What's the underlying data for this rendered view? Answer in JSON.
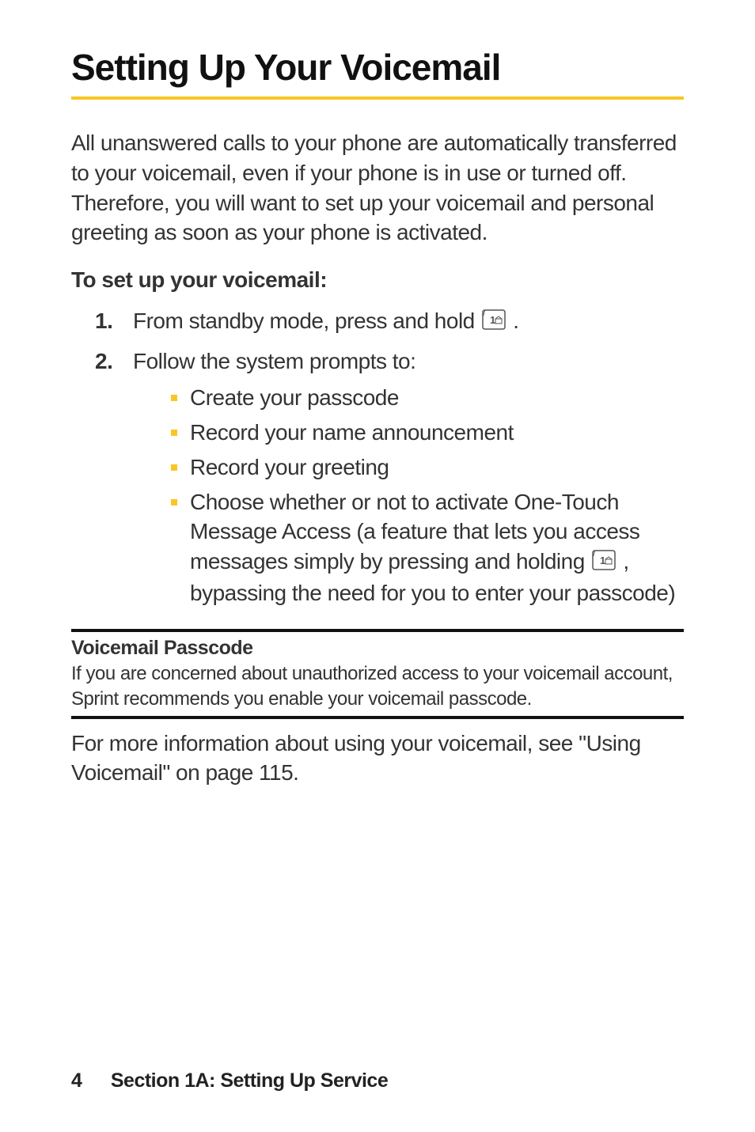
{
  "title": "Setting Up Your Voicemail",
  "intro": "All unanswered calls to your phone are automatically transferred to your voicemail, even if your phone is in use or turned off. Therefore, you will want to set up your voicemail and personal greeting as soon as your phone is activated.",
  "subhead": "To set up your voicemail:",
  "steps": {
    "s1_num": "1.",
    "s1_pre": "From standby mode, press and hold ",
    "s1_post": ".",
    "s2_num": "2.",
    "s2_text": "Follow the system prompts to:",
    "bullets": {
      "b1": "Create your passcode",
      "b2": "Record your name announcement",
      "b3": "Record your greeting",
      "b4_pre": "Choose whether or not to activate One-Touch Message Access (a feature that lets you access messages simply by pressing and holding ",
      "b4_post": ", bypassing the need for you to enter your passcode)"
    }
  },
  "box": {
    "title": "Voicemail Passcode",
    "body": "If you are concerned about unauthorized access to your voicemail account, Sprint recommends you enable your voicemail passcode."
  },
  "outro": "For more information about using your voicemail, see \"Using Voicemail\" on page 115.",
  "footer": {
    "page": "4",
    "section": "Section 1A: Setting Up Service"
  }
}
